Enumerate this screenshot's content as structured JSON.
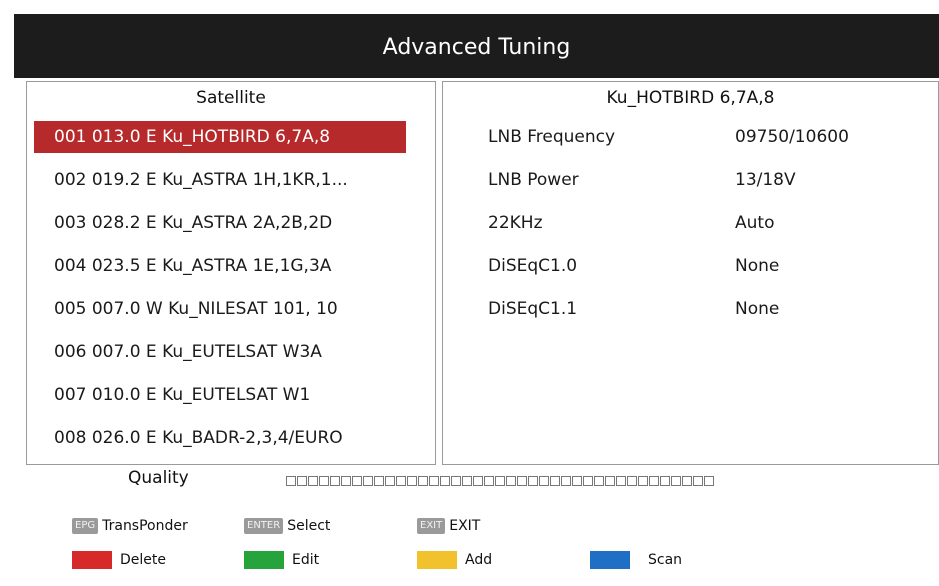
{
  "window": {
    "title": "Advanced Tuning"
  },
  "satellite_panel": {
    "header": "Satellite",
    "selected_index": 0,
    "items": [
      {
        "label": "001 013.0 E  Ku_HOTBIRD 6,7A,8"
      },
      {
        "label": "002 019.2 E  Ku_ASTRA 1H,1KR,1..."
      },
      {
        "label": "003 028.2 E  Ku_ASTRA 2A,2B,2D"
      },
      {
        "label": "004 023.5 E  Ku_ASTRA 1E,1G,3A"
      },
      {
        "label": "005 007.0 W  Ku_NILESAT 101, 10"
      },
      {
        "label": "006 007.0 E  Ku_EUTELSAT W3A"
      },
      {
        "label": "007 010.0 E  Ku_EUTELSAT W1"
      },
      {
        "label": "008 026.0 E  Ku_BADR-2,3,4/EURO"
      }
    ]
  },
  "details_panel": {
    "header": "Ku_HOTBIRD 6,7A,8",
    "params": [
      {
        "label": "LNB Frequency",
        "value": "09750/10600"
      },
      {
        "label": "LNB Power",
        "value": "13/18V"
      },
      {
        "label": "22KHz",
        "value": "Auto"
      },
      {
        "label": "DiSEqC1.0",
        "value": "None"
      },
      {
        "label": "DiSEqC1.1",
        "value": "None"
      }
    ]
  },
  "quality": {
    "label": "Quality",
    "level": 0
  },
  "help": {
    "epg": {
      "key": "EPG",
      "label": "TransPonder"
    },
    "enter": {
      "key": "ENTER",
      "label": "Select"
    },
    "exit": {
      "key": "EXIT",
      "label": "EXIT"
    },
    "red": {
      "label": "Delete",
      "color": "#d62a2a"
    },
    "green": {
      "label": "Edit",
      "color": "#27a33b"
    },
    "yellow": {
      "label": "Add",
      "color": "#f2c12e"
    },
    "blue": {
      "label": "Scan",
      "color": "#1f6fc4"
    }
  }
}
